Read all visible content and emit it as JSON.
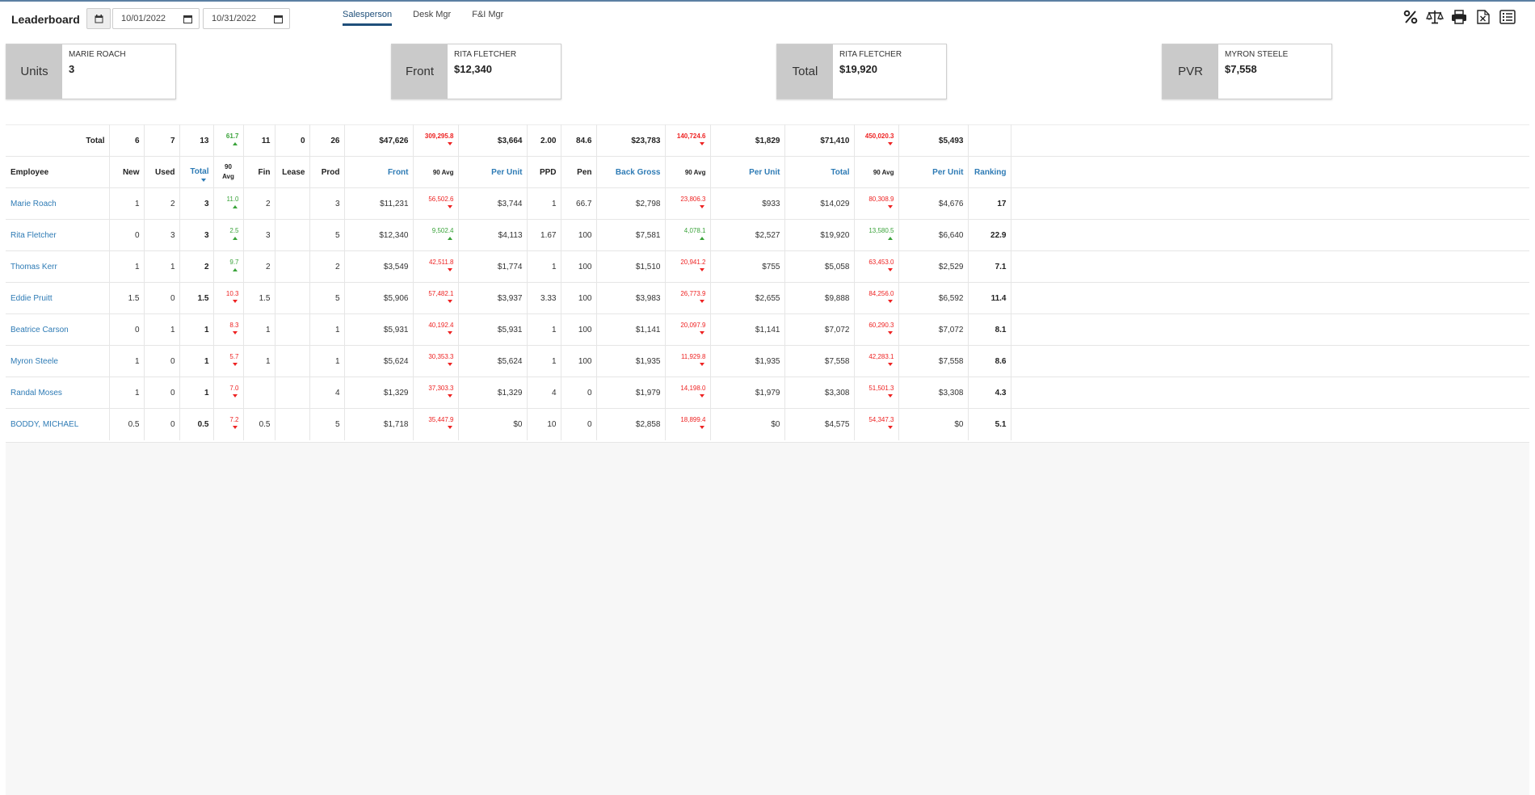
{
  "header": {
    "title": "Leaderboard",
    "date_from": "10/01/2022",
    "date_to": "10/31/2022",
    "tabs": [
      {
        "label": "Salesperson",
        "active": true
      },
      {
        "label": "Desk Mgr",
        "active": false
      },
      {
        "label": "F&I Mgr",
        "active": false
      }
    ],
    "tools": [
      "percent-icon",
      "balance-scale-icon",
      "print-icon",
      "excel-icon",
      "list-icon"
    ]
  },
  "cards": [
    {
      "label": "Units",
      "name": "MARIE ROACH",
      "value": "3"
    },
    {
      "label": "Front",
      "name": "RITA FLETCHER",
      "value": "$12,340"
    },
    {
      "label": "Total",
      "name": "RITA FLETCHER",
      "value": "$19,920"
    },
    {
      "label": "PVR",
      "name": "MYRON STEELE",
      "value": "$7,558"
    }
  ],
  "totals": {
    "label": "Total",
    "new": "6",
    "used": "7",
    "total": "13",
    "avg": "61.7",
    "avg_dir": "up",
    "fin": "11",
    "lease": "0",
    "prod": "26",
    "front": "$47,626",
    "front_avg": "309,295.8",
    "front_avg_dir": "down",
    "front_pu": "$3,664",
    "ppd": "2.00",
    "pen": "84.6",
    "back": "$23,783",
    "back_avg": "140,724.6",
    "back_avg_dir": "down",
    "back_pu": "$1,829",
    "tot": "$71,410",
    "tot_avg": "450,020.3",
    "tot_avg_dir": "down",
    "tot_pu": "$5,493",
    "rank": ""
  },
  "columns": {
    "employee": "Employee",
    "new": "New",
    "used": "Used",
    "total": "Total",
    "avg": "90 Avg",
    "fin": "Fin",
    "lease": "Lease",
    "prod": "Prod",
    "front": "Front",
    "front_avg": "90 Avg",
    "front_pu": "Per Unit",
    "ppd": "PPD",
    "pen": "Pen",
    "back": "Back Gross",
    "back_avg": "90 Avg",
    "back_pu": "Per Unit",
    "tot": "Total",
    "tot_avg": "90 Avg",
    "tot_pu": "Per Unit",
    "rank": "Ranking"
  },
  "rows": [
    {
      "employee": "Marie Roach",
      "new": "1",
      "used": "2",
      "total": "3",
      "avg": "11.0",
      "avg_dir": "up",
      "fin": "2",
      "lease": "",
      "prod": "3",
      "front": "$11,231",
      "front_avg": "56,502.6",
      "front_avg_dir": "down",
      "front_pu": "$3,744",
      "ppd": "1",
      "pen": "66.7",
      "back": "$2,798",
      "back_avg": "23,806.3",
      "back_avg_dir": "down",
      "back_pu": "$933",
      "tot": "$14,029",
      "tot_avg": "80,308.9",
      "tot_avg_dir": "down",
      "tot_pu": "$4,676",
      "rank": "17"
    },
    {
      "employee": "Rita Fletcher",
      "new": "0",
      "used": "3",
      "total": "3",
      "avg": "2.5",
      "avg_dir": "up",
      "fin": "3",
      "lease": "",
      "prod": "5",
      "front": "$12,340",
      "front_avg": "9,502.4",
      "front_avg_dir": "up",
      "front_pu": "$4,113",
      "ppd": "1.67",
      "pen": "100",
      "back": "$7,581",
      "back_avg": "4,078.1",
      "back_avg_dir": "up",
      "back_pu": "$2,527",
      "tot": "$19,920",
      "tot_avg": "13,580.5",
      "tot_avg_dir": "up",
      "tot_pu": "$6,640",
      "rank": "22.9"
    },
    {
      "employee": "Thomas Kerr",
      "new": "1",
      "used": "1",
      "total": "2",
      "avg": "9.7",
      "avg_dir": "up",
      "fin": "2",
      "lease": "",
      "prod": "2",
      "front": "$3,549",
      "front_avg": "42,511.8",
      "front_avg_dir": "down",
      "front_pu": "$1,774",
      "ppd": "1",
      "pen": "100",
      "back": "$1,510",
      "back_avg": "20,941.2",
      "back_avg_dir": "down",
      "back_pu": "$755",
      "tot": "$5,058",
      "tot_avg": "63,453.0",
      "tot_avg_dir": "down",
      "tot_pu": "$2,529",
      "rank": "7.1"
    },
    {
      "employee": "Eddie Pruitt",
      "new": "1.5",
      "used": "0",
      "total": "1.5",
      "avg": "10.3",
      "avg_dir": "down",
      "fin": "1.5",
      "lease": "",
      "prod": "5",
      "front": "$5,906",
      "front_avg": "57,482.1",
      "front_avg_dir": "down",
      "front_pu": "$3,937",
      "ppd": "3.33",
      "pen": "100",
      "back": "$3,983",
      "back_avg": "26,773.9",
      "back_avg_dir": "down",
      "back_pu": "$2,655",
      "tot": "$9,888",
      "tot_avg": "84,256.0",
      "tot_avg_dir": "down",
      "tot_pu": "$6,592",
      "rank": "11.4"
    },
    {
      "employee": "Beatrice Carson",
      "new": "0",
      "used": "1",
      "total": "1",
      "avg": "8.3",
      "avg_dir": "down",
      "fin": "1",
      "lease": "",
      "prod": "1",
      "front": "$5,931",
      "front_avg": "40,192.4",
      "front_avg_dir": "down",
      "front_pu": "$5,931",
      "ppd": "1",
      "pen": "100",
      "back": "$1,141",
      "back_avg": "20,097.9",
      "back_avg_dir": "down",
      "back_pu": "$1,141",
      "tot": "$7,072",
      "tot_avg": "60,290.3",
      "tot_avg_dir": "down",
      "tot_pu": "$7,072",
      "rank": "8.1"
    },
    {
      "employee": "Myron Steele",
      "new": "1",
      "used": "0",
      "total": "1",
      "avg": "5.7",
      "avg_dir": "down",
      "fin": "1",
      "lease": "",
      "prod": "1",
      "front": "$5,624",
      "front_avg": "30,353.3",
      "front_avg_dir": "down",
      "front_pu": "$5,624",
      "ppd": "1",
      "pen": "100",
      "back": "$1,935",
      "back_avg": "11,929.8",
      "back_avg_dir": "down",
      "back_pu": "$1,935",
      "tot": "$7,558",
      "tot_avg": "42,283.1",
      "tot_avg_dir": "down",
      "tot_pu": "$7,558",
      "rank": "8.6"
    },
    {
      "employee": "Randal Moses",
      "new": "1",
      "used": "0",
      "total": "1",
      "avg": "7.0",
      "avg_dir": "down",
      "fin": "",
      "lease": "",
      "prod": "4",
      "front": "$1,329",
      "front_avg": "37,303.3",
      "front_avg_dir": "down",
      "front_pu": "$1,329",
      "ppd": "4",
      "pen": "0",
      "back": "$1,979",
      "back_avg": "14,198.0",
      "back_avg_dir": "down",
      "back_pu": "$1,979",
      "tot": "$3,308",
      "tot_avg": "51,501.3",
      "tot_avg_dir": "down",
      "tot_pu": "$3,308",
      "rank": "4.3"
    },
    {
      "employee": "BODDY, MICHAEL",
      "new": "0.5",
      "used": "0",
      "total": "0.5",
      "avg": "7.2",
      "avg_dir": "down",
      "fin": "0.5",
      "lease": "",
      "prod": "5",
      "front": "$1,718",
      "front_avg": "35,447.9",
      "front_avg_dir": "down",
      "front_pu": "$0",
      "ppd": "10",
      "pen": "0",
      "back": "$2,858",
      "back_avg": "18,899.4",
      "back_avg_dir": "down",
      "back_pu": "$0",
      "tot": "$4,575",
      "tot_avg": "54,347.3",
      "tot_avg_dir": "down",
      "tot_pu": "$0",
      "rank": "5.1"
    }
  ],
  "colors": {
    "accent": "#1f4f7a",
    "link": "#2e7bb5",
    "up": "#3aa33a",
    "down": "#e22222",
    "card_label_bg": "#cacaca"
  }
}
